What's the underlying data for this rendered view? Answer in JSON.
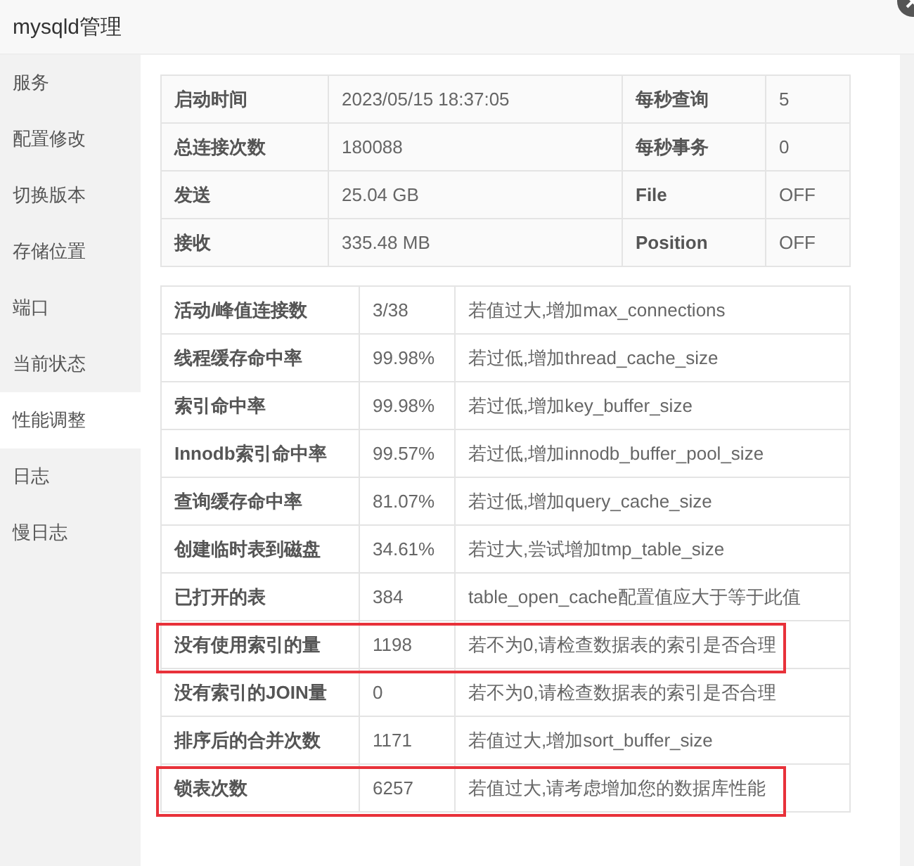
{
  "window": {
    "title": "mysqld管理"
  },
  "sidebar": {
    "items": [
      {
        "label": "服务",
        "selected": false
      },
      {
        "label": "配置修改",
        "selected": false
      },
      {
        "label": "切换版本",
        "selected": false
      },
      {
        "label": "存储位置",
        "selected": false
      },
      {
        "label": "端口",
        "selected": false
      },
      {
        "label": "当前状态",
        "selected": false
      },
      {
        "label": "性能调整",
        "selected": true
      },
      {
        "label": "日志",
        "selected": false
      },
      {
        "label": "慢日志",
        "selected": false
      }
    ]
  },
  "summary_table": {
    "rows": [
      {
        "cells": [
          "启动时间",
          "2023/05/15 18:37:05",
          "每秒查询",
          "5"
        ]
      },
      {
        "cells": [
          "总连接次数",
          "180088",
          "每秒事务",
          "0"
        ]
      },
      {
        "cells": [
          "发送",
          "25.04 GB",
          "File",
          "OFF"
        ]
      },
      {
        "cells": [
          "接收",
          "335.48 MB",
          "Position",
          "OFF"
        ]
      }
    ]
  },
  "tuning_table": {
    "rows": [
      {
        "name": "活动/峰值连接数",
        "value": "3/38",
        "advice": "若值过大,增加max_connections",
        "highlighted": false
      },
      {
        "name": "线程缓存命中率",
        "value": "99.98%",
        "advice": "若过低,增加thread_cache_size",
        "highlighted": false
      },
      {
        "name": "索引命中率",
        "value": "99.98%",
        "advice": "若过低,增加key_buffer_size",
        "highlighted": false
      },
      {
        "name": "Innodb索引命中率",
        "value": "99.57%",
        "advice": "若过低,增加innodb_buffer_pool_size",
        "highlighted": false
      },
      {
        "name": "查询缓存命中率",
        "value": "81.07%",
        "advice": "若过低,增加query_cache_size",
        "highlighted": false
      },
      {
        "name": "创建临时表到磁盘",
        "value": "34.61%",
        "advice": "若过大,尝试增加tmp_table_size",
        "highlighted": false
      },
      {
        "name": "已打开的表",
        "value": "384",
        "advice": "table_open_cache配置值应大于等于此值",
        "highlighted": false
      },
      {
        "name": "没有使用索引的量",
        "value": "1198",
        "advice": "若不为0,请检查数据表的索引是否合理",
        "highlighted": true
      },
      {
        "name": "没有索引的JOIN量",
        "value": "0",
        "advice": "若不为0,请检查数据表的索引是否合理",
        "highlighted": false
      },
      {
        "name": "排序后的合并次数",
        "value": "1171",
        "advice": "若值过大,增加sort_buffer_size",
        "highlighted": false
      },
      {
        "name": "锁表次数",
        "value": "6257",
        "advice": "若值过大,请考虑增加您的数据库性能",
        "highlighted": true
      }
    ]
  }
}
